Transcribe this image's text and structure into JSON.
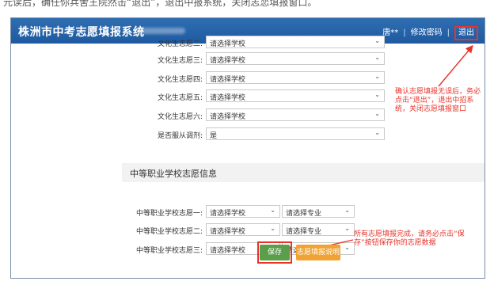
{
  "caption": "元读后，确任你兵舍王院然击“退出”，退出中报系统，关闭志恋填报窗口。",
  "header": {
    "title": "株洲市中考志愿填报系统",
    "user_name": "唐**",
    "change_password": "修改密码",
    "separator": "|",
    "logout": "退出"
  },
  "culture_rows": [
    {
      "label": "文化生志愿二:",
      "value": "请选择学校"
    },
    {
      "label": "文化生志愿三:",
      "value": "请选择学校"
    },
    {
      "label": "文化生志愿四:",
      "value": "请选择学校"
    },
    {
      "label": "文化生志愿五:",
      "value": "请选择学校"
    },
    {
      "label": "文化生志愿六:",
      "value": "请选择学校"
    },
    {
      "label": "是否服从调剂:",
      "value": "是"
    }
  ],
  "vocational": {
    "section_title": "中等职业学校志愿信息",
    "rows": [
      {
        "label": "中等职业学校志愿一:",
        "school": "请选择学校",
        "major": "请选择专业"
      },
      {
        "label": "中等职业学校志愿二:",
        "school": "请选择学校",
        "major": "请选择专业"
      },
      {
        "label": "中等职业学校志愿三:",
        "school": "请选择学校",
        "major": "请选择专业"
      }
    ]
  },
  "annotations": {
    "logout_note": "确认志愿填报无误后，务必点击“退出”，退出中招系统，关闭志愿填报窗口",
    "save_note": "所有志愿填报完成，请务必点击“保存”按钮保存你的志愿数据"
  },
  "buttons": {
    "save": "保存",
    "instructions": "志愿填报说明"
  },
  "colors": {
    "header_bg": "#2f6db1",
    "annotation_red": "#e8332a",
    "save_green": "#5a9e4a",
    "instructions_orange": "#f0a233"
  }
}
